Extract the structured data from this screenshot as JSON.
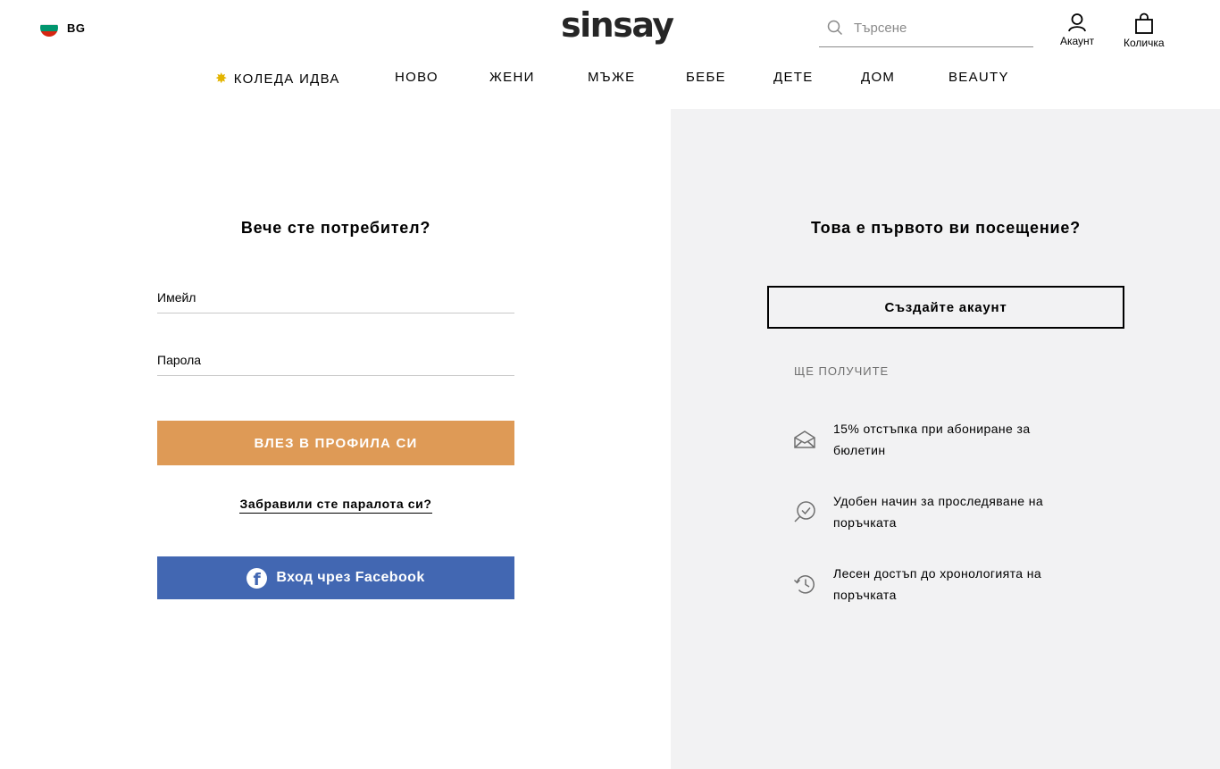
{
  "header": {
    "language_code": "BG",
    "flag_colors": [
      "#ffffff",
      "#00966e",
      "#d62612"
    ],
    "logo_text": "sinsay",
    "search": {
      "placeholder": "Търсене",
      "value": ""
    },
    "account_label": "Акаунт",
    "cart_label": "Количка"
  },
  "nav": {
    "items": [
      {
        "label": "КОЛЕДА ИДВА",
        "icon": "star-icon"
      },
      {
        "label": "НОВО"
      },
      {
        "label": "ЖЕНИ"
      },
      {
        "label": "МЪЖЕ"
      },
      {
        "label": "БЕБЕ"
      },
      {
        "label": "ДЕТЕ"
      },
      {
        "label": "ДОМ"
      },
      {
        "label": "BEAUTY"
      }
    ]
  },
  "login": {
    "title": "Вече сте потребител?",
    "email_placeholder": "Имейл",
    "password_placeholder": "Парола",
    "submit_label": "ВЛЕЗ В ПРОФИЛА СИ",
    "forgot_label": "Забравили сте паралота си?",
    "facebook_label": "Вход чрез Facebook"
  },
  "register": {
    "title": "Това е първото ви посещение?",
    "create_label": "Създайте акаунт",
    "benefits_title": "ЩЕ ПОЛУЧИТЕ",
    "benefits": [
      {
        "icon": "envelope-icon",
        "text": "15% отстъпка при абониране за бюлетин"
      },
      {
        "icon": "search-check-icon",
        "text": "Удобен начин за проследяване на поръчката"
      },
      {
        "icon": "history-icon",
        "text": "Лесен достъп до хронологията на поръчката"
      }
    ]
  },
  "colors": {
    "login_button": "#de9a56",
    "facebook_button": "#4267b2",
    "right_panel_bg": "#f2f2f3"
  }
}
